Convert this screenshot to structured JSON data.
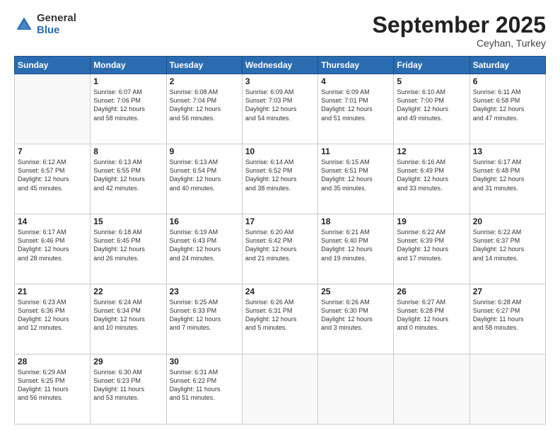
{
  "logo": {
    "general": "General",
    "blue": "Blue"
  },
  "title": "September 2025",
  "subtitle": "Ceyhan, Turkey",
  "weekdays": [
    "Sunday",
    "Monday",
    "Tuesday",
    "Wednesday",
    "Thursday",
    "Friday",
    "Saturday"
  ],
  "weeks": [
    [
      {
        "day": "",
        "info": ""
      },
      {
        "day": "1",
        "info": "Sunrise: 6:07 AM\nSunset: 7:06 PM\nDaylight: 12 hours\nand 58 minutes."
      },
      {
        "day": "2",
        "info": "Sunrise: 6:08 AM\nSunset: 7:04 PM\nDaylight: 12 hours\nand 56 minutes."
      },
      {
        "day": "3",
        "info": "Sunrise: 6:09 AM\nSunset: 7:03 PM\nDaylight: 12 hours\nand 54 minutes."
      },
      {
        "day": "4",
        "info": "Sunrise: 6:09 AM\nSunset: 7:01 PM\nDaylight: 12 hours\nand 51 minutes."
      },
      {
        "day": "5",
        "info": "Sunrise: 6:10 AM\nSunset: 7:00 PM\nDaylight: 12 hours\nand 49 minutes."
      },
      {
        "day": "6",
        "info": "Sunrise: 6:11 AM\nSunset: 6:58 PM\nDaylight: 12 hours\nand 47 minutes."
      }
    ],
    [
      {
        "day": "7",
        "info": "Sunrise: 6:12 AM\nSunset: 6:57 PM\nDaylight: 12 hours\nand 45 minutes."
      },
      {
        "day": "8",
        "info": "Sunrise: 6:13 AM\nSunset: 6:55 PM\nDaylight: 12 hours\nand 42 minutes."
      },
      {
        "day": "9",
        "info": "Sunrise: 6:13 AM\nSunset: 6:54 PM\nDaylight: 12 hours\nand 40 minutes."
      },
      {
        "day": "10",
        "info": "Sunrise: 6:14 AM\nSunset: 6:52 PM\nDaylight: 12 hours\nand 38 minutes."
      },
      {
        "day": "11",
        "info": "Sunrise: 6:15 AM\nSunset: 6:51 PM\nDaylight: 12 hours\nand 35 minutes."
      },
      {
        "day": "12",
        "info": "Sunrise: 6:16 AM\nSunset: 6:49 PM\nDaylight: 12 hours\nand 33 minutes."
      },
      {
        "day": "13",
        "info": "Sunrise: 6:17 AM\nSunset: 6:48 PM\nDaylight: 12 hours\nand 31 minutes."
      }
    ],
    [
      {
        "day": "14",
        "info": "Sunrise: 6:17 AM\nSunset: 6:46 PM\nDaylight: 12 hours\nand 28 minutes."
      },
      {
        "day": "15",
        "info": "Sunrise: 6:18 AM\nSunset: 6:45 PM\nDaylight: 12 hours\nand 26 minutes."
      },
      {
        "day": "16",
        "info": "Sunrise: 6:19 AM\nSunset: 6:43 PM\nDaylight: 12 hours\nand 24 minutes."
      },
      {
        "day": "17",
        "info": "Sunrise: 6:20 AM\nSunset: 6:42 PM\nDaylight: 12 hours\nand 21 minutes."
      },
      {
        "day": "18",
        "info": "Sunrise: 6:21 AM\nSunset: 6:40 PM\nDaylight: 12 hours\nand 19 minutes."
      },
      {
        "day": "19",
        "info": "Sunrise: 6:22 AM\nSunset: 6:39 PM\nDaylight: 12 hours\nand 17 minutes."
      },
      {
        "day": "20",
        "info": "Sunrise: 6:22 AM\nSunset: 6:37 PM\nDaylight: 12 hours\nand 14 minutes."
      }
    ],
    [
      {
        "day": "21",
        "info": "Sunrise: 6:23 AM\nSunset: 6:36 PM\nDaylight: 12 hours\nand 12 minutes."
      },
      {
        "day": "22",
        "info": "Sunrise: 6:24 AM\nSunset: 6:34 PM\nDaylight: 12 hours\nand 10 minutes."
      },
      {
        "day": "23",
        "info": "Sunrise: 6:25 AM\nSunset: 6:33 PM\nDaylight: 12 hours\nand 7 minutes."
      },
      {
        "day": "24",
        "info": "Sunrise: 6:26 AM\nSunset: 6:31 PM\nDaylight: 12 hours\nand 5 minutes."
      },
      {
        "day": "25",
        "info": "Sunrise: 6:26 AM\nSunset: 6:30 PM\nDaylight: 12 hours\nand 3 minutes."
      },
      {
        "day": "26",
        "info": "Sunrise: 6:27 AM\nSunset: 6:28 PM\nDaylight: 12 hours\nand 0 minutes."
      },
      {
        "day": "27",
        "info": "Sunrise: 6:28 AM\nSunset: 6:27 PM\nDaylight: 11 hours\nand 58 minutes."
      }
    ],
    [
      {
        "day": "28",
        "info": "Sunrise: 6:29 AM\nSunset: 6:25 PM\nDaylight: 11 hours\nand 56 minutes."
      },
      {
        "day": "29",
        "info": "Sunrise: 6:30 AM\nSunset: 6:23 PM\nDaylight: 11 hours\nand 53 minutes."
      },
      {
        "day": "30",
        "info": "Sunrise: 6:31 AM\nSunset: 6:22 PM\nDaylight: 11 hours\nand 51 minutes."
      },
      {
        "day": "",
        "info": ""
      },
      {
        "day": "",
        "info": ""
      },
      {
        "day": "",
        "info": ""
      },
      {
        "day": "",
        "info": ""
      }
    ]
  ]
}
